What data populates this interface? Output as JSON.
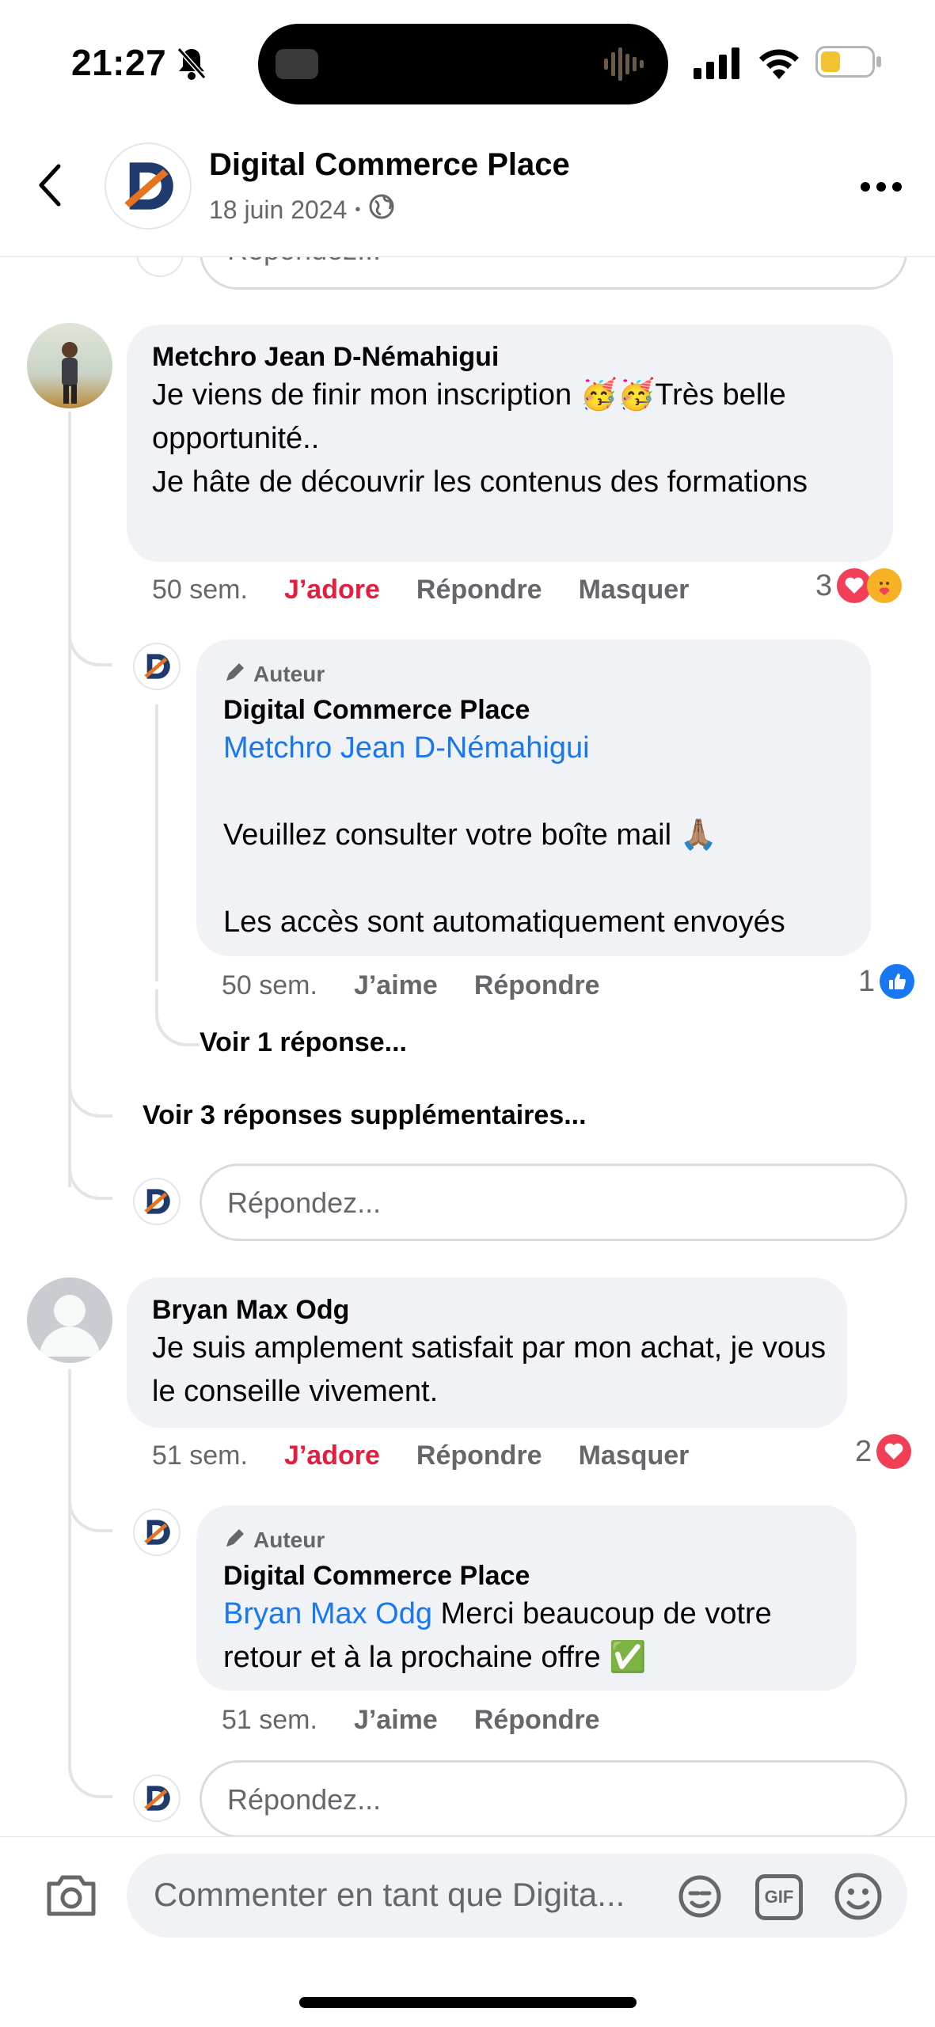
{
  "status": {
    "time": "21:27"
  },
  "header": {
    "title": "Digital Commerce Place",
    "date": "18 juin 2024",
    "separator": "•"
  },
  "top_reply": {
    "placeholder": "Répondez..."
  },
  "comment1": {
    "author": "Metchro Jean D-Némahigui",
    "text": "Je viens de finir mon inscription 🥳🥳Très belle opportunité..\nJe hâte de découvrir les contenus des formations",
    "time": "50 sem.",
    "reaction": "J’adore",
    "reply": "Répondre",
    "hide": "Masquer",
    "reaction_count": "3",
    "reply1": {
      "badge": "Auteur",
      "author": "Digital Commerce Place",
      "mention": "Metchro Jean D-Némahigui",
      "line1": "Veuillez consulter votre boîte mail 🙏🏽",
      "line2": "Les accès sont automatiquement envoyés",
      "time": "50 sem.",
      "like": "J’aime",
      "reply": "Répondre",
      "like_count": "1",
      "see_reply": "Voir 1 réponse..."
    },
    "see_more": "Voir 3 réponses supplémentaires...",
    "reply_placeholder": "Répondez..."
  },
  "comment2": {
    "author": "Bryan Max Odg",
    "text": "Je suis amplement satisfait par mon achat, je vous le conseille vivement.",
    "time": "51 sem.",
    "reaction": "J’adore",
    "reply": "Répondre",
    "hide": "Masquer",
    "reaction_count": "2",
    "reply1": {
      "badge": "Auteur",
      "author": "Digital Commerce Place",
      "mention": "Bryan Max Odg",
      "text": " Merci beaucoup de votre retour et à la prochaine offre ✅",
      "time": "51 sem.",
      "like": "J’aime",
      "reply": "Répondre"
    },
    "reply_placeholder": "Répondez..."
  },
  "composer": {
    "placeholder": "Commenter en tant que Digita...",
    "gif_label": "GIF"
  },
  "colors": {
    "accent": "#1877f2",
    "love": "#e41e3f",
    "brand_orange": "#e8731f",
    "brand_navy": "#1f3b6e"
  }
}
